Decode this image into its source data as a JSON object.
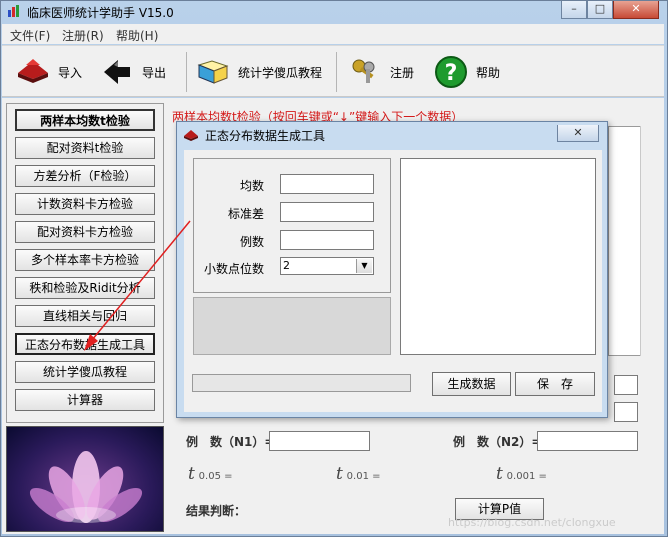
{
  "window": {
    "title": "临床医师统计学助手 V15.0",
    "min_btn": "–",
    "max_btn": "□",
    "close_btn": "✕"
  },
  "menu": [
    {
      "label": "文件(F)"
    },
    {
      "label": "注册(R)"
    },
    {
      "label": "帮助(H)"
    }
  ],
  "toolbar": {
    "import_label": "导入",
    "export_label": "导出",
    "tutorial_label": "统计学傻瓜教程",
    "register_label": "注册",
    "help_label": "帮助"
  },
  "nav": [
    {
      "label": "两样本均数t检验"
    },
    {
      "label": "配对资料t检验"
    },
    {
      "label": "方差分析（F检验）"
    },
    {
      "label": "计数资料卡方检验"
    },
    {
      "label": "配对资料卡方检验"
    },
    {
      "label": "多个样本率卡方检验"
    },
    {
      "label": "秩和检验及Ridit分析"
    },
    {
      "label": "直线相关与回归"
    },
    {
      "label": "正态分布数据生成工具"
    },
    {
      "label": "统计学傻瓜教程"
    },
    {
      "label": "计算器"
    }
  ],
  "main": {
    "instruction": "两样本均数t检验（按回车键或“↓”键输入下一个数据）",
    "n1_label": "例　数（N1）=",
    "n2_label": "例　数（N2）=",
    "t1_sub": "0.05 =",
    "t2_sub": "0.01 =",
    "t3_sub": "0.001 =",
    "t_symbol": "t",
    "result_label": "结果判断：",
    "calc_button": "计算P值",
    "watermark": "https://blog.csdn.net/clongxue"
  },
  "dialog": {
    "title": "正态分布数据生成工具",
    "close": "✕",
    "mean_label": "均数",
    "sd_label": "标准差",
    "n_label": "例数",
    "decimals_label": "小数点位数",
    "decimals_value": "2",
    "generate_button": "生成数据",
    "save_button": "保　存"
  }
}
